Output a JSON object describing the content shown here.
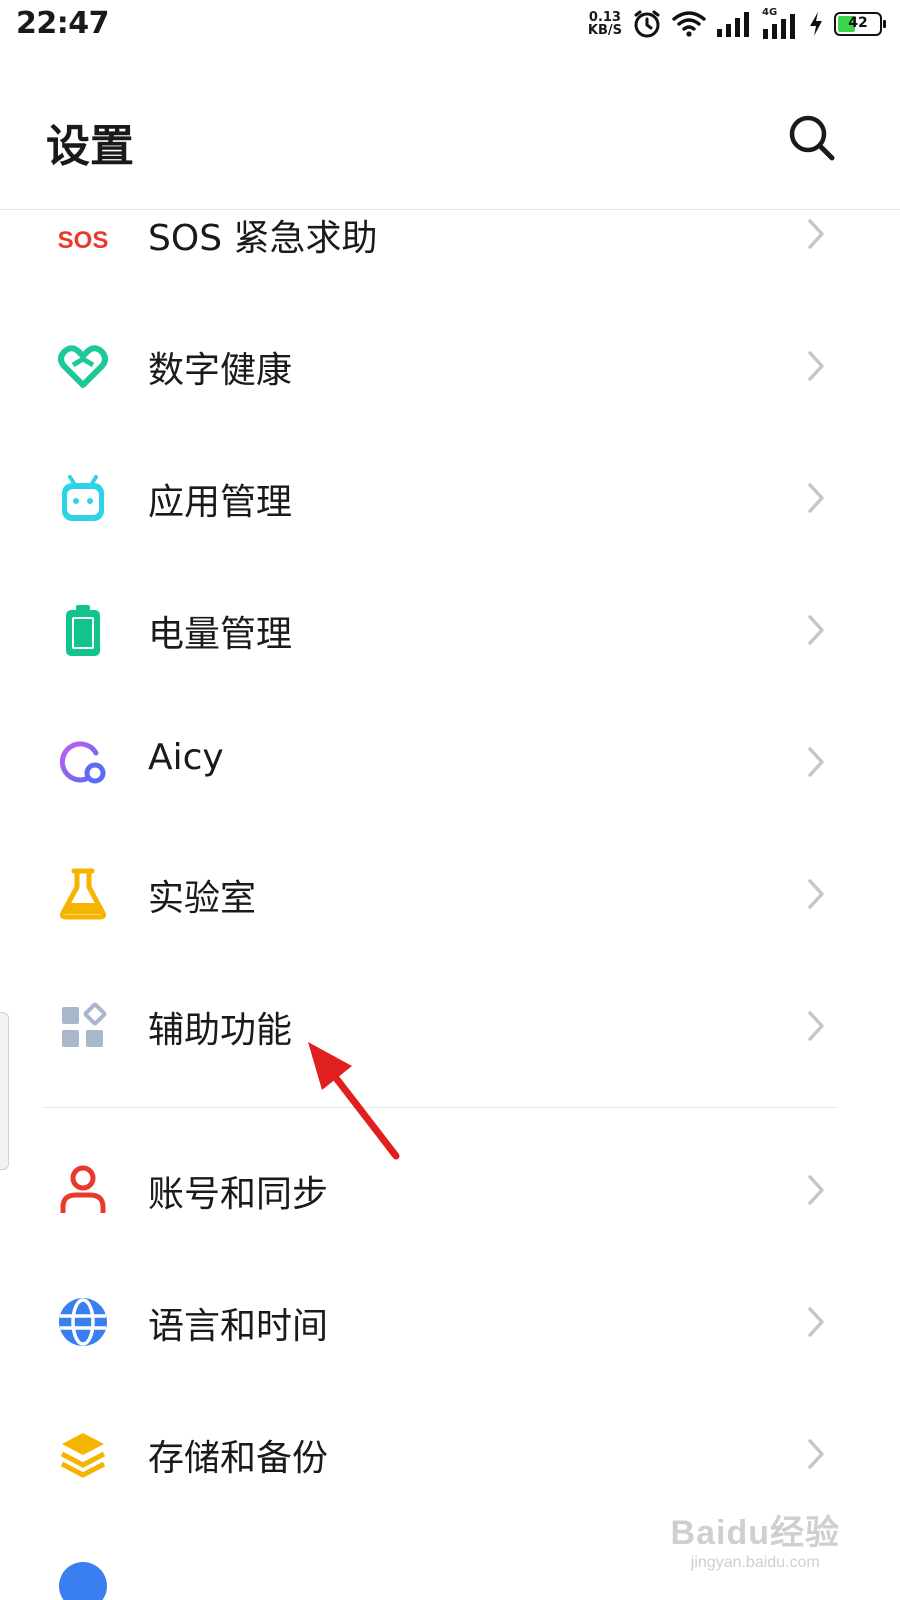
{
  "status_bar": {
    "time": "22:47",
    "net_speed_value": "0.13",
    "net_speed_unit": "KB/S",
    "network_type": "4G",
    "battery_level": "42",
    "battery_fraction": 0.42,
    "battery_color": "#3bd44a"
  },
  "header": {
    "title": "设置",
    "search_icon": "search-icon"
  },
  "settings": {
    "items": [
      {
        "label": "SOS 紧急求助",
        "icon": "sos-icon",
        "icon_text": "SOS",
        "color": "#e8392b"
      },
      {
        "label": "数字健康",
        "icon": "digital-wellbeing-icon",
        "color": "#1fc89a"
      },
      {
        "label": "应用管理",
        "icon": "android-app-icon",
        "color": "#2ed3e6"
      },
      {
        "label": "电量管理",
        "icon": "battery-icon",
        "color": "#12c48c"
      },
      {
        "label": "Aicy",
        "icon": "aicy-icon",
        "color": "#8a5cf6"
      },
      {
        "label": "实验室",
        "icon": "flask-icon",
        "color": "#f5b400"
      },
      {
        "label": "辅助功能",
        "icon": "accessibility-grid-icon",
        "color": "#a9b7cc"
      },
      {
        "label": "账号和同步",
        "icon": "account-icon",
        "color": "#e8392b"
      },
      {
        "label": "语言和时间",
        "icon": "globe-icon",
        "color": "#3a7ff0"
      },
      {
        "label": "存储和备份",
        "icon": "storage-layers-icon",
        "color": "#f5b400"
      },
      {
        "label": "",
        "icon": "partial-icon",
        "color": "#3a7ff0"
      }
    ]
  },
  "annotation": {
    "arrow_color": "#e0201f"
  },
  "watermark": {
    "main": "Baidu经验",
    "sub": "jingyan.baidu.com"
  }
}
